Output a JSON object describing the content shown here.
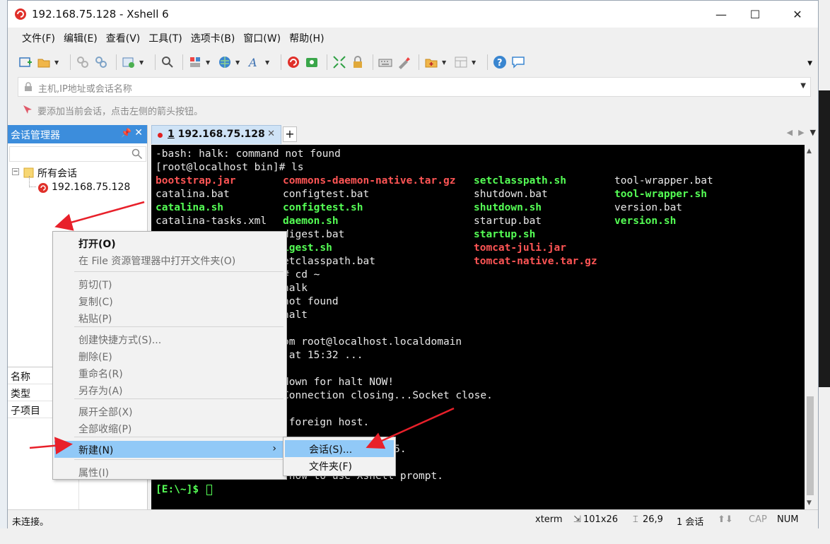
{
  "window": {
    "title": "192.168.75.128 - Xshell 6",
    "minimize": "—",
    "maximize": "☐",
    "close": "✕"
  },
  "menubar": {
    "items": [
      "文件(F)",
      "编辑(E)",
      "查看(V)",
      "工具(T)",
      "选项卡(B)",
      "窗口(W)",
      "帮助(H)"
    ]
  },
  "address": {
    "placeholder": "主机,IP地址或会话名称"
  },
  "hint": {
    "text": "要添加当前会话，点击左侧的箭头按钮。"
  },
  "session_panel": {
    "title": "会话管理器",
    "tree": [
      {
        "label": "所有会话"
      },
      {
        "label": "192.168.75.128"
      }
    ],
    "properties": [
      "名称",
      "类型",
      "子项目"
    ]
  },
  "tab": {
    "index": "1",
    "label": "192.168.75.128",
    "add": "+"
  },
  "terminal": {
    "lines": [
      "-bash: halk: command not found",
      "[root@localhost bin]# ls"
    ],
    "ls_columns": [
      [
        {
          "text": "bootstrap.jar",
          "color": "red"
        },
        {
          "text": "catalina.bat",
          "color": "plain"
        },
        {
          "text": "catalina.sh",
          "color": "green"
        },
        {
          "text": "catalina-tasks.xml",
          "color": "plain"
        }
      ],
      [
        {
          "text": "commons-daemon-native.tar.gz",
          "color": "red"
        },
        {
          "text": "configtest.bat",
          "color": "plain"
        },
        {
          "text": "configtest.sh",
          "color": "green"
        },
        {
          "text": "daemon.sh",
          "color": "green"
        },
        {
          "text": "digest.bat",
          "color": "plain"
        },
        {
          "text": "igest.sh",
          "color": "green"
        },
        {
          "text": "etclasspath.bat",
          "color": "plain"
        }
      ],
      [
        {
          "text": "setclasspath.sh",
          "color": "green"
        },
        {
          "text": "shutdown.bat",
          "color": "plain"
        },
        {
          "text": "shutdown.sh",
          "color": "green"
        },
        {
          "text": "startup.bat",
          "color": "plain"
        },
        {
          "text": "startup.sh",
          "color": "green"
        },
        {
          "text": "tomcat-juli.jar",
          "color": "red"
        },
        {
          "text": "tomcat-native.tar.gz",
          "color": "red"
        }
      ],
      [
        {
          "text": "tool-wrapper.bat",
          "color": "plain"
        },
        {
          "text": "tool-wrapper.sh",
          "color": "green"
        },
        {
          "text": "version.bat",
          "color": "plain"
        },
        {
          "text": "version.sh",
          "color": "green"
        }
      ]
    ],
    "tail_lines": [
      "# cd ~",
      "halk",
      "not found",
      "halt",
      "",
      "om root@localhost.localdomain",
      " at 15:32 ...",
      "",
      "down for halt NOW!",
      "Connection closing...Socket close.",
      "",
      " foreign host.",
      "",
      "75.128) at 15:32:45.",
      "",
      " how to use Xshell prompt."
    ],
    "prompt": "[E:\\~]$ "
  },
  "context_menu": {
    "items": [
      {
        "label": "打开(O)",
        "style": "bold"
      },
      {
        "label": "在 File 资源管理器中打开文件夹(O)",
        "style": "disabled"
      },
      {
        "label": "剪切(T)",
        "style": "disabled"
      },
      {
        "label": "复制(C)",
        "style": "disabled"
      },
      {
        "label": "粘贴(P)",
        "style": "disabled"
      },
      {
        "label": "创建快捷方式(S)...",
        "style": "disabled"
      },
      {
        "label": "删除(E)",
        "style": "disabled"
      },
      {
        "label": "重命名(R)",
        "style": "disabled"
      },
      {
        "label": "另存为(A)",
        "style": "disabled"
      },
      {
        "label": "展开全部(X)",
        "style": "disabled"
      },
      {
        "label": "全部收缩(P)",
        "style": "disabled"
      },
      {
        "label": "新建(N)",
        "style": "highlight"
      },
      {
        "label": "属性(I)",
        "style": "disabled"
      }
    ],
    "submenu": [
      "会话(S)...",
      "文件夹(F)"
    ]
  },
  "statusbar": {
    "left": "未连接。",
    "term": "xterm",
    "size": "101x26",
    "cursor": "26,9",
    "sessions": "1 会话",
    "cap": "CAP",
    "num": "NUM"
  },
  "colors": {
    "accent": "#3c8ddc",
    "highlight": "#91c9f7",
    "term_red": "#ff5555",
    "term_green": "#55ff55",
    "arrow": "#e8202a"
  }
}
